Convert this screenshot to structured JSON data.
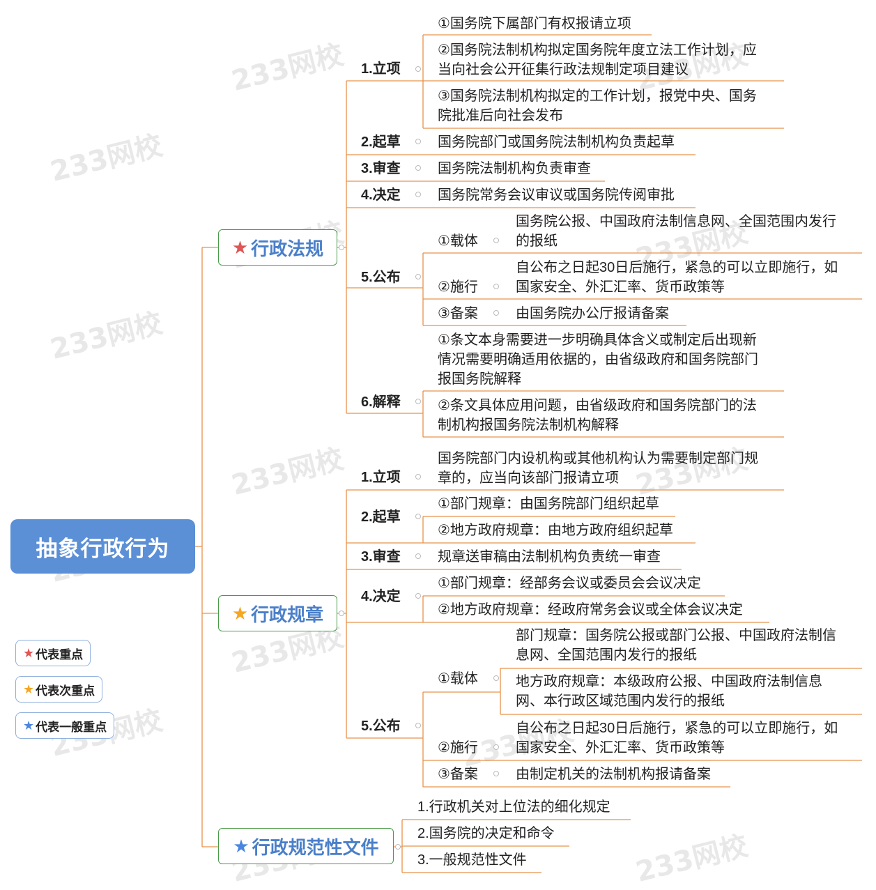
{
  "root": "抽象行政行为",
  "colors": {
    "root_bg": "#5b8fd6",
    "line": "#e8924a",
    "red_star": "#e05555",
    "orange_star": "#f5a623",
    "blue_star": "#4a86e0"
  },
  "watermark": "233网校",
  "legend": [
    {
      "icon": "red-star-icon",
      "label": "代表重点"
    },
    {
      "icon": "orange-star-icon",
      "label": "代表次重点"
    },
    {
      "icon": "blue-star-icon",
      "label": "代表一般重点"
    }
  ],
  "branches": {
    "xzfg": {
      "title": "行政法规",
      "lixiang": {
        "label": "1.立项",
        "i1": "①国务院下属部门有权报请立项",
        "i2a": "②国务院法制机构拟定国务院年度立法工作计划，应",
        "i2b": "当向社会公开征集行政法规制定项目建议",
        "i3a": "③国务院法制机构拟定的工作计划，报党中央、国务",
        "i3b": "院批准后向社会发布"
      },
      "qicao": {
        "label": "2.起草",
        "text": "国务院部门或国务院法制机构负责起草"
      },
      "shencha": {
        "label": "3.审查",
        "text": "国务院法制机构负责审查"
      },
      "jueding": {
        "label": "4.决定",
        "text": "国务院常务会议审议或国务院传阅审批"
      },
      "gongbu": {
        "label": "5.公布",
        "zaiti": "①载体",
        "zaiti_a": "国务院公报、中国政府法制信息网、全国范围内发行",
        "zaiti_b": "的报纸",
        "shixing": "②施行",
        "shixing_a": "自公布之日起30日后施行，紧急的可以立即施行，如",
        "shixing_b": "国家安全、外汇汇率、货币政策等",
        "beian": "③备案",
        "beian_t": "由国务院办公厅报请备案"
      },
      "jieshi": {
        "label": "6.解释",
        "i1a": "①条文本身需要进一步明确具体含义或制定后出现新",
        "i1b": "情况需要明确适用依据的，由省级政府和国务院部门",
        "i1c": "报国务院解释",
        "i2a": "②条文具体应用问题，由省级政府和国务院部门的法",
        "i2b": "制机构报国务院法制机构解释"
      }
    },
    "xzgz": {
      "title": "行政规章",
      "lixiang": {
        "label": "1.立项",
        "a": "国务院部门内设机构或其他机构认为需要制定部门规",
        "b": "章的，应当向该部门报请立项"
      },
      "qicao": {
        "label": "2.起草",
        "i1": "①部门规章：由国务院部门组织起草",
        "i2": "②地方政府规章：由地方政府组织起草"
      },
      "shencha": {
        "label": "3.审查",
        "text": "规章送审稿由法制机构负责统一审查"
      },
      "jueding": {
        "label": "4.决定",
        "i1": "①部门规章：经部务会议或委员会会议决定",
        "i2": "②地方政府规章：经政府常务会议或全体会议决定"
      },
      "gongbu": {
        "label": "5.公布",
        "zaiti": "①载体",
        "bm_a": "部门规章：国务院公报或部门公报、中国政府法制信",
        "bm_b": "息网、全国范围内发行的报纸",
        "df_a": "地方政府规章：本级政府公报、中国政府法制信息",
        "df_b": "网、本行政区域范围内发行的报纸",
        "shixing": "②施行",
        "shixing_a": "自公布之日起30日后施行，紧急的可以立即施行，如",
        "shixing_b": "国家安全、外汇汇率、货币政策等",
        "beian": "③备案",
        "beian_t": "由制定机关的法制机构报请备案"
      }
    },
    "xzgfx": {
      "title": "行政规范性文件",
      "i1": "1.行政机关对上位法的细化规定",
      "i2": "2.国务院的决定和命令",
      "i3": "3.一般规范性文件"
    }
  }
}
